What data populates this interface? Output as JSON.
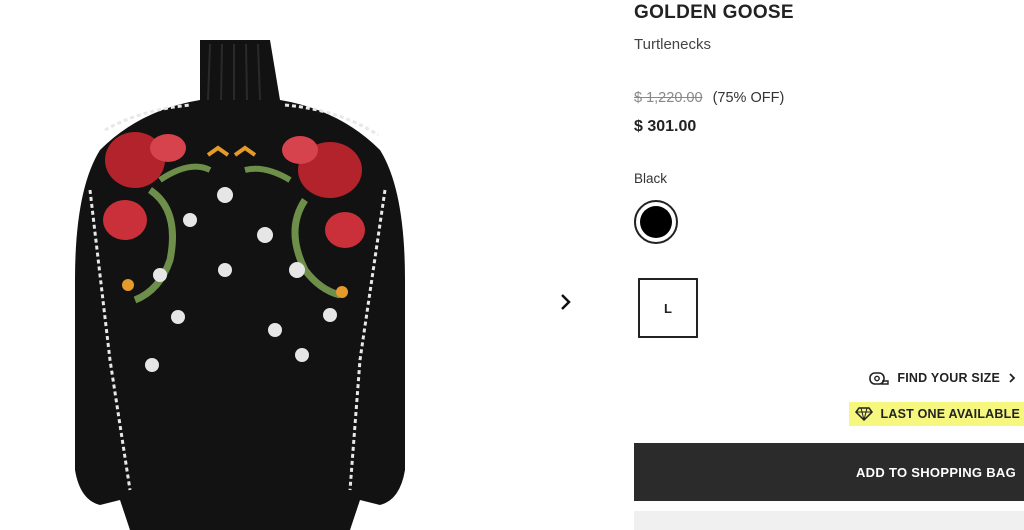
{
  "product": {
    "brand": "GOLDEN GOOSE",
    "category": "Turtlenecks",
    "original_price": "$ 1,220.00",
    "discount": "(75% OFF)",
    "price": "$ 301.00",
    "color_label": "Black",
    "size": "L"
  },
  "links": {
    "find_size": "FIND YOUR SIZE"
  },
  "badges": {
    "last_one": "LAST ONE AVAILABLE",
    "last_one_bg": "#f6f77e"
  },
  "actions": {
    "add_to_bag": "ADD TO SHOPPING BAG"
  },
  "icons": {
    "next": "chevron-right-icon",
    "measure": "measuring-tape-icon",
    "diamond": "diamond-icon"
  },
  "colors": {
    "primary_button": "#2b2b2b",
    "swatch": "#000000"
  }
}
